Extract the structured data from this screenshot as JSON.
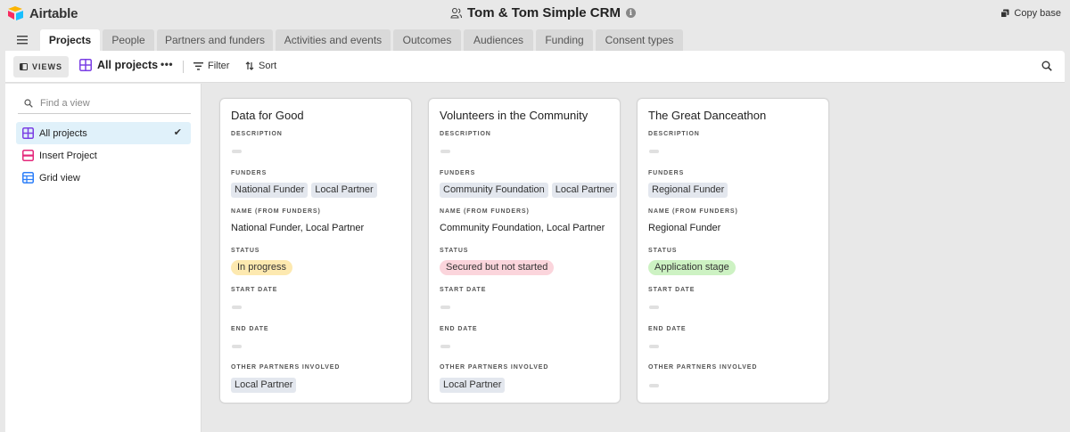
{
  "app": {
    "name": "Airtable",
    "base_title": "Tom & Tom Simple CRM",
    "copy_base": "Copy base"
  },
  "tabs": [
    "Projects",
    "People",
    "Partners and funders",
    "Activities and events",
    "Outcomes",
    "Audiences",
    "Funding",
    "Consent types"
  ],
  "toolbar": {
    "views": "VIEWS",
    "current_view": "All projects",
    "more": "•••",
    "filter": "Filter",
    "sort": "Sort"
  },
  "sidebar": {
    "search_placeholder": "Find a view",
    "views": [
      {
        "label": "All projects",
        "icon": "gallery-icon",
        "color": "#7b3fe4",
        "active": true
      },
      {
        "label": "Insert Project",
        "icon": "form-icon",
        "color": "#e4287b"
      },
      {
        "label": "Grid view",
        "icon": "grid-icon",
        "color": "#2d7ff9"
      }
    ]
  },
  "field_labels": {
    "description": "DESCRIPTION",
    "funders": "FUNDERS",
    "name_from_funders": "NAME (FROM FUNDERS)",
    "status": "STATUS",
    "start_date": "START DATE",
    "end_date": "END DATE",
    "other_partners": "OTHER PARTNERS INVOLVED"
  },
  "cards": [
    {
      "title": "Data for Good",
      "funders": [
        "National Funder",
        "Local Partner"
      ],
      "name_from_funders": "National Funder, Local Partner",
      "status": "In progress",
      "status_color": "#fde9b0",
      "other_partners": [
        "Local Partner"
      ]
    },
    {
      "title": "Volunteers in the Community",
      "funders": [
        "Community Foundation",
        "Local Partner"
      ],
      "name_from_funders": "Community Foundation, Local Partner",
      "status": "Secured but not started",
      "status_color": "#fbd5dc",
      "other_partners": [
        "Local Partner"
      ]
    },
    {
      "title": "The Great Danceathon",
      "funders": [
        "Regional Funder"
      ],
      "name_from_funders": "Regional Funder",
      "status": "Application stage",
      "status_color": "#cdf2c3",
      "other_partners": []
    }
  ]
}
